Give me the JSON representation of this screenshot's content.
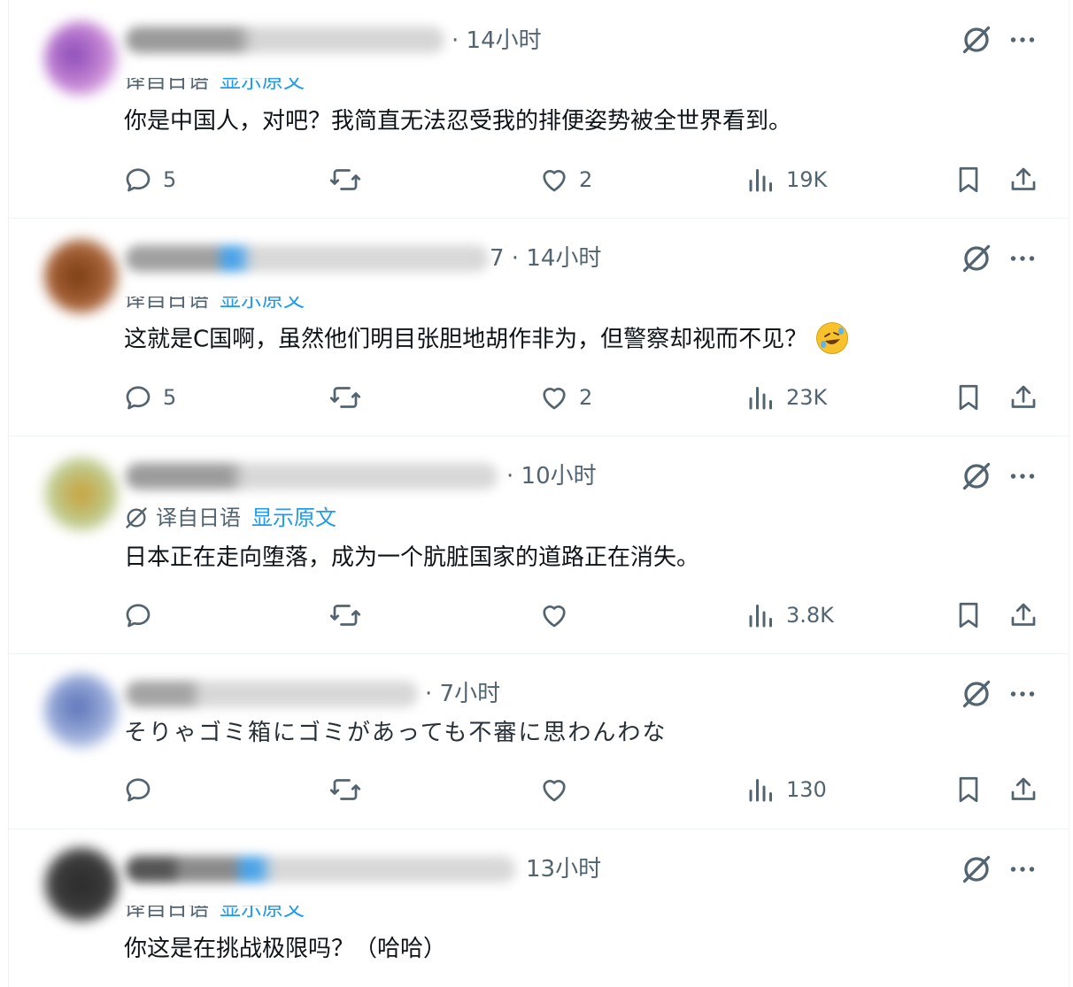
{
  "colors": {
    "link": "#1d9bf0",
    "muted": "#536471",
    "text": "#0f1419",
    "divider": "#eff3f4"
  },
  "icons": {
    "reply": "speech-bubble-icon",
    "retweet": "retweet-icon",
    "like": "heart-icon",
    "views": "bar-chart-icon",
    "bookmark": "bookmark-icon",
    "share": "share-upload-icon",
    "grok": "grok-slash-circle-icon",
    "more": "more-dots-icon",
    "translate": "translate-globe-icon"
  },
  "translate_label": "译自日语",
  "show_original_label": "显示原文",
  "replies": [
    {
      "time": "· 14小时",
      "text": "你是中国人，对吧？我简直无法忍受我的排便姿势被全世界看到。",
      "reply_count": "5",
      "like_count": "2",
      "views": "19K",
      "translated": true
    },
    {
      "time": "7 · 14小时",
      "text": "这就是C国啊，虽然他们明目张胆地胡作非为，但警察却视而不见？",
      "emoji": "rolling-on-floor-laughing-emoji",
      "reply_count": "5",
      "like_count": "2",
      "views": "23K",
      "translated": true
    },
    {
      "time": "· 10小时",
      "text": "日本正在走向堕落，成为一个肮脏国家的道路正在消失。",
      "reply_count": "",
      "like_count": "",
      "views": "3.8K",
      "translated": true
    },
    {
      "time": "· 7小时",
      "text": "そりゃゴミ箱にゴミがあっても不審に思わんわな",
      "reply_count": "",
      "like_count": "",
      "views": "130",
      "translated": false
    },
    {
      "time": "13小时",
      "text": "你这是在挑战极限吗？（哈哈）",
      "translated": true
    }
  ]
}
